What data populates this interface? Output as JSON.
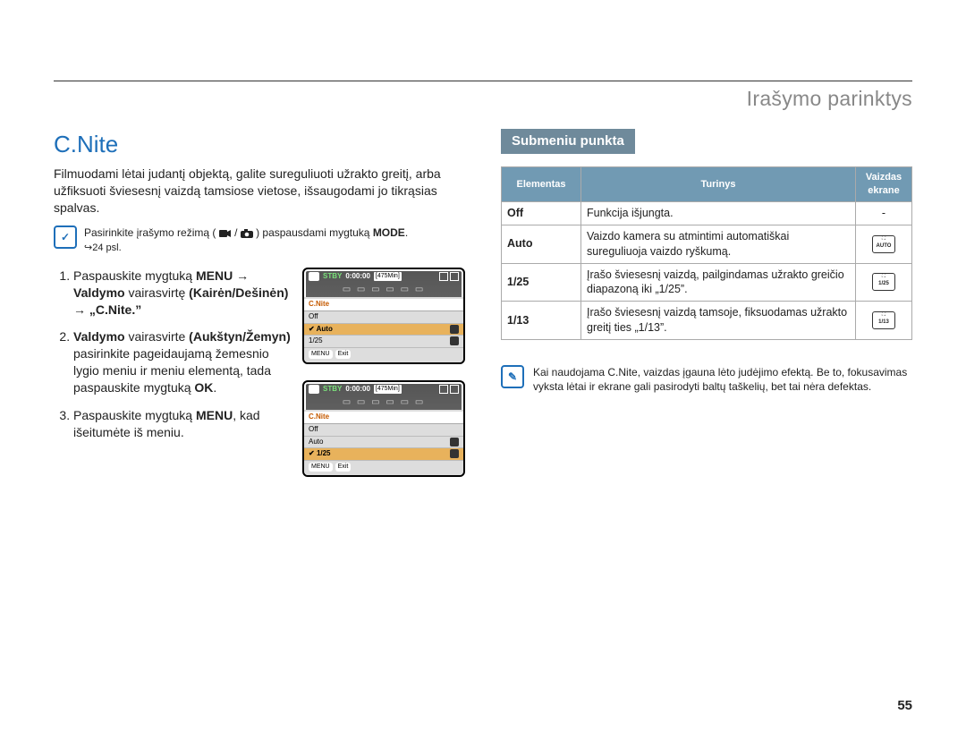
{
  "breadcrumb": "Irašymo parinktys",
  "section_title": "C.Nite",
  "intro": "Filmuodami lėtai judantį objektą, galite sureguliuoti užrakto greitį, arba užfiksuoti šviesesnį vaizdą tamsiose vietose, išsaugodami jo tikrąsias spalvas.",
  "mode_note_pre": "Pasirinkite įrašymo režimą (",
  "mode_note_mid": " / ",
  "mode_note_post": ") paspausdami mygtuką ",
  "mode_note_bold": "MODE",
  "mode_note_end": ".",
  "page_ref": "↪24 psl.",
  "step1_a": "Paspauskite mygtuką ",
  "step1_b": "MENU",
  "step1_arrow": " → ",
  "step1_c": "Valdymo",
  "step1_d": " vairasvirtę ",
  "step1_e": "(Kairėn/Dešinėn)",
  "step1_f": " → ",
  "step1_g": "„C.Nite.”",
  "step2_a": "Valdymo",
  "step2_b": " vairasvirte ",
  "step2_c": "(Aukštyn/Žemyn)",
  "step2_d": " pasirinkite pageidaujamą žemesnio lygio meniu ir meniu elementą, tada paspauskite mygtuką ",
  "step2_e": "OK",
  "step2_f": ".",
  "step3_a": "Paspauskite mygtuką ",
  "step3_b": "MENU",
  "step3_c": ", kad išeitumėte iš meniu.",
  "screen": {
    "stby": "STBY",
    "time": "0:00:00",
    "min": "[475Min]",
    "menu_title": "C.Nite",
    "items": [
      "Off",
      "Auto",
      "1/25"
    ],
    "menu_label": "MENU",
    "exit": "Exit"
  },
  "submenu_title": "Submeniu punkta",
  "table": {
    "h1": "Elementas",
    "h2": "Turinys",
    "h3a": "Vaizdas",
    "h3b": "ekrane",
    "rows": [
      {
        "elem": "Off",
        "desc": "Funkcija išjungta.",
        "icon": "-",
        "iconlabel": ""
      },
      {
        "elem": "Auto",
        "desc": "Vaizdo kamera su atmintimi automatiškai sureguliuoja vaizdo ryškumą.",
        "icon": "box",
        "iconlabel": "AUTO"
      },
      {
        "elem": "1/25",
        "desc": "Įrašo šviesesnį vaizdą, pailgindamas užrakto greičio diapazoną iki „1/25”.",
        "icon": "box",
        "iconlabel": "1/25"
      },
      {
        "elem": "1/13",
        "desc": "Įrašo šviesesnį vaizdą tamsoje, fiksuodamas užrakto greitį ties „1/13”.",
        "icon": "box",
        "iconlabel": "1/13"
      }
    ]
  },
  "tip": "Kai naudojama C.Nite, vaizdas įgauna lėto judėjimo efektą. Be to, fokusavimas vyksta lėtai ir ekrane gali pasirodyti baltų taškelių, bet tai nėra defektas.",
  "page_number": "55",
  "icons": {
    "check": "✓",
    "video": "🎥",
    "camera": "📷"
  }
}
